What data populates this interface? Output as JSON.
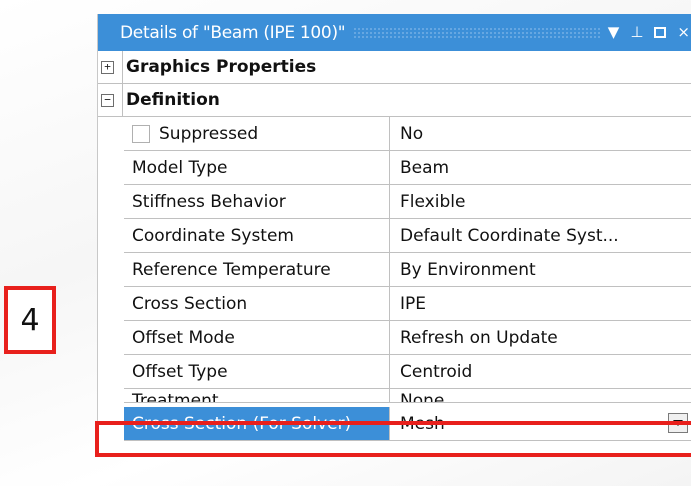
{
  "window": {
    "title": "Details of \"Beam (IPE 100)\"",
    "icons": [
      "chevron-down-icon",
      "pin-icon",
      "maximize-icon",
      "close-icon"
    ]
  },
  "groups": {
    "graphics": {
      "label": "Graphics Properties",
      "expander": "+"
    },
    "definition": {
      "label": "Definition",
      "expander": "−"
    }
  },
  "rows": [
    {
      "label": "Suppressed",
      "value": "No",
      "checkbox": true
    },
    {
      "label": "Model Type",
      "value": "Beam"
    },
    {
      "label": "Stiffness Behavior",
      "value": "Flexible"
    },
    {
      "label": "Coordinate System",
      "value": "Default Coordinate Syst..."
    },
    {
      "label": "Reference Temperature",
      "value": "By Environment"
    },
    {
      "label": "Cross Section",
      "value": "IPE"
    },
    {
      "label": "Offset Mode",
      "value": "Refresh on Update"
    },
    {
      "label": "Offset Type",
      "value": "Centroid"
    },
    {
      "label": "Treatment",
      "value": "None"
    },
    {
      "label": "Cross Section (For Solver)",
      "value": "Mesh",
      "selected": true,
      "dropdown": true
    }
  ],
  "callout": {
    "number": "4"
  },
  "colors": {
    "accent": "#3c8fd8",
    "highlight": "#e8201c",
    "grid": "#c0c0c0"
  }
}
